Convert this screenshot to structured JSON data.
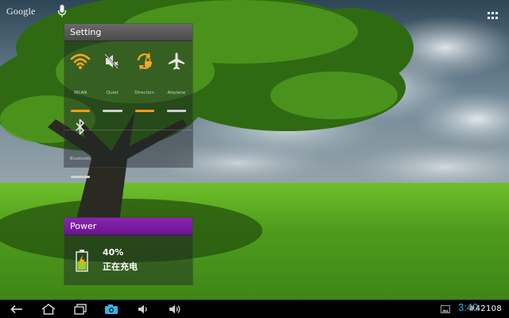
{
  "top_bar": {
    "google_label": "Google"
  },
  "setting_widget": {
    "title": "Setting",
    "toggles": [
      {
        "label": "WLAN",
        "icon": "wifi-icon",
        "state": "on"
      },
      {
        "label": "Quiet",
        "icon": "quiet-speaker-icon",
        "state": "off"
      },
      {
        "label": "Direction",
        "icon": "rotation-lock-icon",
        "state": "on"
      },
      {
        "label": "Airplane",
        "icon": "airplane-icon",
        "state": "off"
      },
      {
        "label": "Bluetooth",
        "icon": "bluetooth-icon",
        "state": "off"
      }
    ]
  },
  "power_widget": {
    "title": "Power",
    "battery_level": "40%",
    "status": "正在充电"
  },
  "status_bar": {
    "clock": "3:40",
    "watermark": "#42108"
  },
  "colors": {
    "toggle_on": "#f59a1e",
    "toggle_off": "#cfcfcf",
    "power_header": "#7b1fa2",
    "clock": "#33b5e5",
    "battery_fill": "#9ccc2a"
  }
}
